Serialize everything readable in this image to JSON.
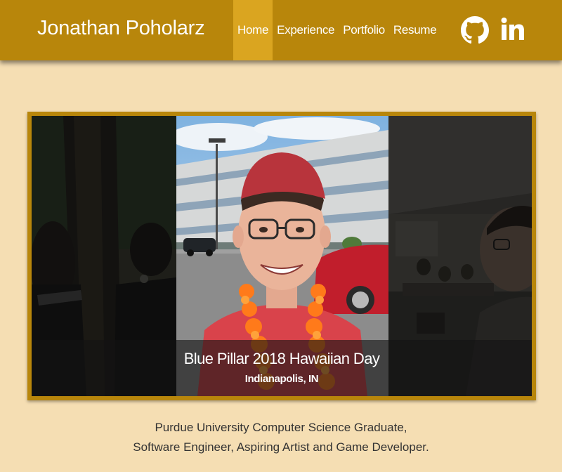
{
  "site": {
    "brand": "Jonathan Poholarz"
  },
  "nav": {
    "items": [
      {
        "label": "Home",
        "active": true
      },
      {
        "label": "Experience",
        "active": false
      },
      {
        "label": "Portfolio",
        "active": false
      },
      {
        "label": "Resume",
        "active": false
      }
    ],
    "social": [
      {
        "icon": "github-icon"
      },
      {
        "icon": "linkedin-icon"
      }
    ]
  },
  "carousel": {
    "caption_title": "Blue Pillar 2018 Hawaiian Day",
    "caption_location": "Indianapolis, IN"
  },
  "intro": {
    "line1": "Purdue University Computer Science Graduate,",
    "line2": "Software Engineer, Aspiring Artist and Game Developer."
  },
  "colors": {
    "navbar": "#b8860b",
    "nav_active": "#daa520",
    "page_background": "#f5deb3",
    "text": "#333333"
  }
}
